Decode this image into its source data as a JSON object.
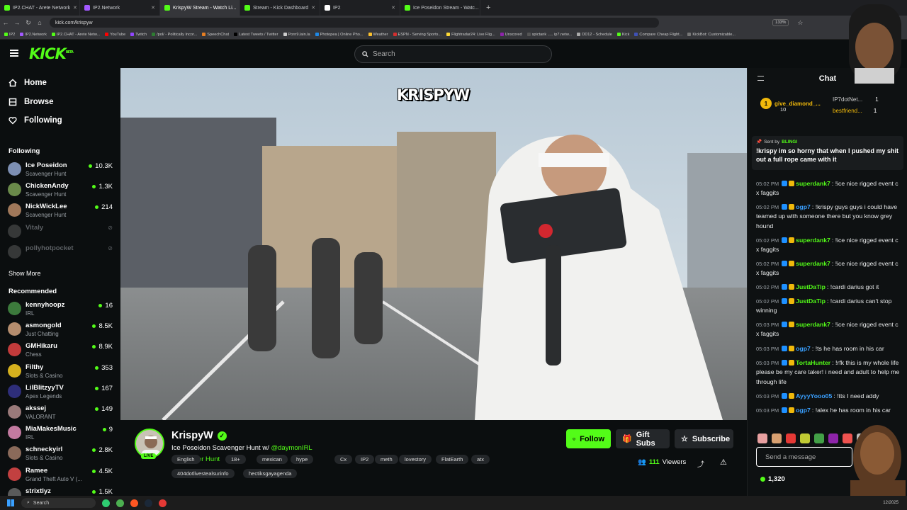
{
  "browser": {
    "tabs": [
      {
        "label": "IP2.CHAT - Arete Network",
        "color": "#53fc18"
      },
      {
        "label": "IP2.Network",
        "color": "#a259ff"
      },
      {
        "label": "KrispyW Stream - Watch Li...",
        "color": "#53fc18",
        "active": true
      },
      {
        "label": "Stream - Kick Dashboard",
        "color": "#53fc18"
      },
      {
        "label": "IP2",
        "color": "#ffffff"
      },
      {
        "label": "Ice Poseidon Stream - Watc...",
        "color": "#53fc18"
      }
    ],
    "url": "kick.com/krispyw",
    "zoom": "133%",
    "bookmarks": [
      "IP2",
      "IP2.Network",
      "IP2.CHAT - Arete Netw...",
      "YouTube",
      "Twitch",
      "/pol/ - Politically Incor...",
      "SpeechChat",
      "Latest Tweets / Twitter",
      "Porn9.lain.la",
      "Photopea | Online Pho...",
      "Weather",
      "ESPN - Serving Sports...",
      "Flightradar24: Live Flig...",
      "Unscored",
      "spictank ..... ip7.netw...",
      "DD12 - Schedule",
      "Kick",
      "Compare Cheap Flight...",
      "KickBot: Customizable..."
    ]
  },
  "header": {
    "logo": "KICK",
    "logo_badge": "BETA",
    "search_placeholder": "Search"
  },
  "sidebar": {
    "nav": [
      {
        "label": "Home",
        "icon": "home-icon"
      },
      {
        "label": "Browse",
        "icon": "browse-icon"
      },
      {
        "label": "Following",
        "icon": "heart-icon"
      }
    ],
    "following_title": "Following",
    "following": [
      {
        "name": "Ice Poseidon",
        "category": "Scavenger Hunt",
        "viewers": "10.3K",
        "color": "#7d8fb3"
      },
      {
        "name": "ChickenAndy",
        "category": "Scavenger Hunt",
        "viewers": "1.3K",
        "color": "#6a8a4a"
      },
      {
        "name": "NickWickLee",
        "category": "Scavenger Hunt",
        "viewers": "214",
        "color": "#a0785a"
      },
      {
        "name": "Vitaly",
        "category": "",
        "viewers": "",
        "color": "#888888",
        "offline": true
      },
      {
        "name": "pollyhotpocket",
        "category": "",
        "viewers": "",
        "color": "#888888",
        "offline": true
      }
    ],
    "show_more": "Show More",
    "recommended_title": "Recommended",
    "recommended": [
      {
        "name": "kennyhoopz",
        "category": "IRL",
        "viewers": "16",
        "color": "#3c7a3c"
      },
      {
        "name": "asmongold",
        "category": "Just Chatting",
        "viewers": "8.5K",
        "color": "#b58d6e"
      },
      {
        "name": "GMHikaru",
        "category": "Chess",
        "viewers": "8.9K",
        "color": "#c23b3b"
      },
      {
        "name": "Filthy",
        "category": "Slots & Casino",
        "viewers": "353",
        "color": "#d6b11e"
      },
      {
        "name": "LilBlitzyyTV",
        "category": "Apex Legends",
        "viewers": "167",
        "color": "#2e2e7a"
      },
      {
        "name": "akssej",
        "category": "VALORANT",
        "viewers": "149",
        "color": "#9a7a7a"
      },
      {
        "name": "MiaMakesMusic",
        "category": "IRL",
        "viewers": "9",
        "color": "#c27aa0"
      },
      {
        "name": "schneckyirl",
        "category": "Slots & Casino",
        "viewers": "2.8K",
        "color": "#8a6a5a"
      },
      {
        "name": "Ramee",
        "category": "Grand Theft Auto V (...",
        "viewers": "4.5K",
        "color": "#c24040"
      },
      {
        "name": "strixtlyz",
        "category": "",
        "viewers": "1.5K",
        "color": "#5a5a5a"
      }
    ]
  },
  "video": {
    "overlay_logo": "KRISPYW"
  },
  "stream": {
    "name": "KrispyW",
    "live": "LIVE",
    "title": "Ice Poseidon Scavenger Hunt w/",
    "title_mention": "@daymonIRL",
    "category": "Scavenger Hunt",
    "tags": [
      "English",
      "18+",
      "mexican",
      "hype",
      "Cx",
      "IP2",
      "meth",
      "lovestory",
      "FlatEarth",
      "atx"
    ],
    "tags2": [
      "404dotlivestealsurinfo",
      "hectiksgayagenda"
    ],
    "follow": "Follow",
    "gift_subs": "Gift Subs",
    "subscribe": "Subscribe",
    "viewers_count": "111",
    "viewers_label": "Viewers"
  },
  "chat": {
    "title": "Chat",
    "gifters": [
      {
        "rank": "1",
        "name": "give_diamond_...",
        "count": "10"
      },
      {
        "name": "IP7dotNet...",
        "count": "1"
      },
      {
        "name": "bestfriend...",
        "count": "1"
      }
    ],
    "pinned": {
      "sent_by": "Sent by",
      "sender": "BLINGI",
      "text": "!krispy im so horny that when I pushed my shit out a full rope came with it"
    },
    "messages": [
      {
        "time": "05:02 PM",
        "user": "superdank7",
        "color": "#53fc18",
        "text": "!ice nice rigged event c x faggits"
      },
      {
        "time": "05:02 PM",
        "user": "ogp7",
        "color": "#3aa0ff",
        "text": "!krispy guys guys i could have teamed up with someone there but you know grey hound"
      },
      {
        "time": "05:02 PM",
        "user": "superdank7",
        "color": "#53fc18",
        "text": "!ice nice rigged event c x faggits"
      },
      {
        "time": "05:02 PM",
        "user": "superdank7",
        "color": "#53fc18",
        "text": "!ice nice rigged event c x faggits"
      },
      {
        "time": "05:02 PM",
        "user": "JustDaTip",
        "color": "#53fc18",
        "text": "!cardi darius got it"
      },
      {
        "time": "05:02 PM",
        "user": "JustDaTip",
        "color": "#53fc18",
        "text": "!cardi darius can't stop winning"
      },
      {
        "time": "05:03 PM",
        "user": "superdank7",
        "color": "#53fc18",
        "text": "!ice nice rigged event c x faggits"
      },
      {
        "time": "05:03 PM",
        "user": "ogp7",
        "color": "#3aa0ff",
        "text": "!ts he has room in his car"
      },
      {
        "time": "05:03 PM",
        "user": "TortaHunter",
        "color": "#53fc18",
        "text": "!rfk this is my whole life please be my care taker! i need and adult to help me through life"
      },
      {
        "time": "05:03 PM",
        "user": "AyyyYooo05",
        "color": "#3aa0ff",
        "text": "!tts I need addy"
      },
      {
        "time": "05:03 PM",
        "user": "ogp7",
        "color": "#3aa0ff",
        "text": "!alex he has room in his car"
      }
    ],
    "input_placeholder": "Send a message",
    "points": "1,320"
  },
  "taskbar": {
    "search": "Search",
    "date": "12/2025"
  }
}
